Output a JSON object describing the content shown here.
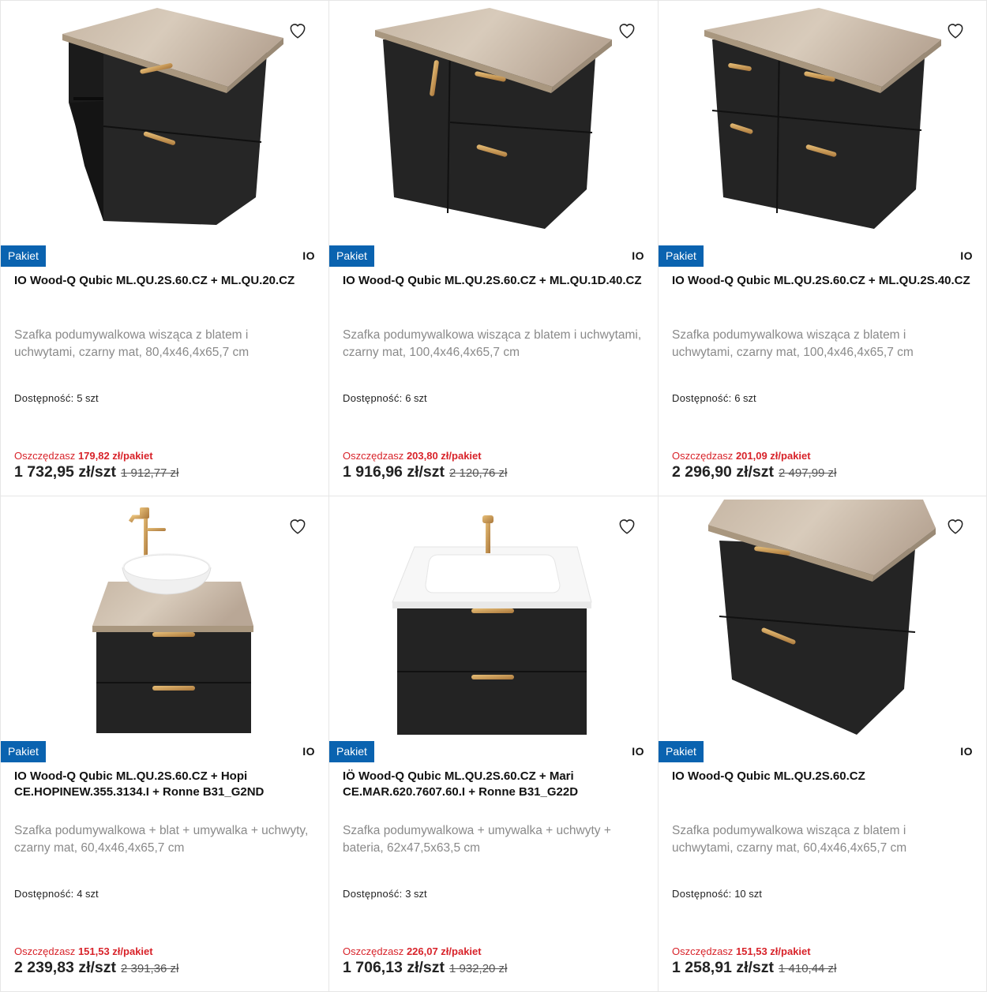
{
  "colors": {
    "badge": "#0a63b0",
    "savings": "#d8232a",
    "text": "#111111",
    "description": "#8a8a8a"
  },
  "products": [
    {
      "badge": "Pakiet",
      "brand": "IO",
      "title": "IO Wood-Q Qubic ML.QU.2S.60.CZ + ML.QU.20.CZ",
      "description": "Szafka podumywalkowa wisząca z blatem i uchwytami, czarny mat, 80,4x46,4x65,7 cm",
      "availability_label": "Dostępność:",
      "availability_value": "5 szt",
      "savings_label": "Oszczędzasz",
      "savings_value": "179,82 zł/pakiet",
      "price": "1 732,95 zł/szt",
      "old_price": "1 912,77 zł",
      "favorite_icon": "heart-icon",
      "image": "cabinet-shelf"
    },
    {
      "badge": "Pakiet",
      "brand": "IO",
      "title": "IO Wood-Q Qubic ML.QU.2S.60.CZ + ML.QU.1D.40.CZ",
      "description": "Szafka podumywalkowa wisząca z blatem i uchwytami, czarny mat, 100,4x46,4x65,7 cm",
      "availability_label": "Dostępność:",
      "availability_value": "6 szt",
      "savings_label": "Oszczędzasz",
      "savings_value": "203,80 zł/pakiet",
      "price": "1 916,96 zł/szt",
      "old_price": "2 120,76 zł",
      "favorite_icon": "heart-icon",
      "image": "cabinet-door"
    },
    {
      "badge": "Pakiet",
      "brand": "IO",
      "title": "IO Wood-Q Qubic ML.QU.2S.60.CZ + ML.QU.2S.40.CZ",
      "description": "Szafka podumywalkowa wisząca z blatem i uchwytami, czarny mat, 100,4x46,4x65,7 cm",
      "availability_label": "Dostępność:",
      "availability_value": "6 szt",
      "savings_label": "Oszczędzasz",
      "savings_value": "201,09 zł/pakiet",
      "price": "2 296,90 zł/szt",
      "old_price": "2 497,99 zł",
      "favorite_icon": "heart-icon",
      "image": "cabinet-four-drawers"
    },
    {
      "badge": "Pakiet",
      "brand": "IO",
      "title": "IO Wood-Q Qubic ML.QU.2S.60.CZ + Hopi CE.HOPINEW.355.3134.I + Ronne B31_G2ND",
      "description": "Szafka podumywalkowa + blat + umywalka + uchwyty, czarny mat, 60,4x46,4x65,7 cm",
      "availability_label": "Dostępność:",
      "availability_value": "4 szt",
      "savings_label": "Oszczędzasz",
      "savings_value": "151,53 zł/pakiet",
      "price": "2 239,83 zł/szt",
      "old_price": "2 391,36 zł",
      "favorite_icon": "heart-icon",
      "image": "cabinet-bowl-sink"
    },
    {
      "badge": "Pakiet",
      "brand": "IO",
      "title": "IÖ Wood-Q Qubic ML.QU.2S.60.CZ + Mari CE.MAR.620.7607.60.I + Ronne B31_G22D",
      "description": "Szafka podumywalkowa + umywalka + uchwyty + bateria, 62x47,5x63,5 cm",
      "availability_label": "Dostępność:",
      "availability_value": "3 szt",
      "savings_label": "Oszczędzasz",
      "savings_value": "226,07 zł/pakiet",
      "price": "1 706,13 zł/szt",
      "old_price": "1 932,20 zł",
      "favorite_icon": "heart-icon",
      "image": "cabinet-inset-sink"
    },
    {
      "badge": "Pakiet",
      "brand": "IO",
      "title": "IO Wood-Q Qubic ML.QU.2S.60.CZ",
      "description": "Szafka podumywalkowa wisząca z blatem i uchwytami, czarny mat, 60,4x46,4x65,7 cm",
      "availability_label": "Dostępność:",
      "availability_value": "10 szt",
      "savings_label": "Oszczędzasz",
      "savings_value": "151,53 zł/pakiet",
      "price": "1 258,91 zł/szt",
      "old_price": "1 410,44 zł",
      "favorite_icon": "heart-icon",
      "image": "cabinet-two-drawers"
    }
  ]
}
